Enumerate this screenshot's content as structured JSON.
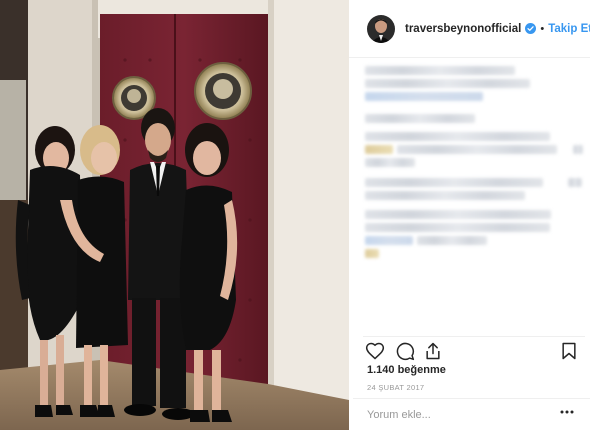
{
  "header": {
    "username": "traversbeynonofficial",
    "separator": "•",
    "follow_label": "Takip Et",
    "verified_icon": "verified-badge-icon"
  },
  "photo": {
    "description_icon": "post-photo"
  },
  "actions": {
    "like_icon": "heart-icon",
    "comment_icon": "comment-icon",
    "share_icon": "share-icon",
    "save_icon": "bookmark-icon"
  },
  "likes": "1.140 beğenme",
  "date": "24 ŞUBAT 2017",
  "comment": {
    "placeholder": "Yorum ekle..."
  },
  "colors": {
    "accent": "#3897f0",
    "text": "#262626",
    "muted": "#999999",
    "divider": "#efefef"
  }
}
